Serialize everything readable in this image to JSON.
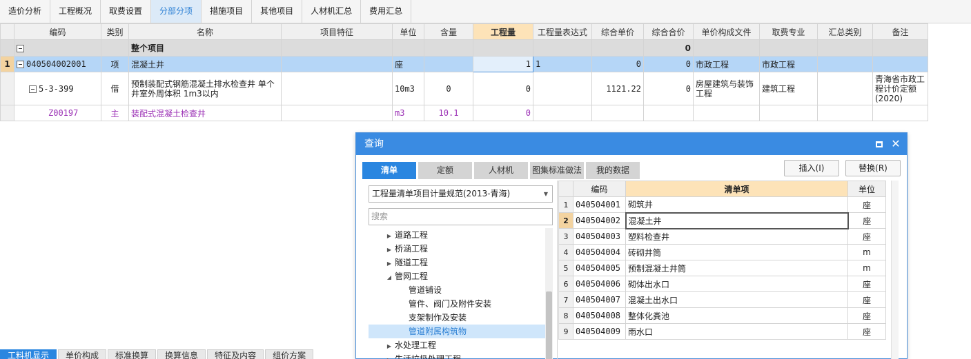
{
  "top_tabs": [
    "造价分析",
    "工程概况",
    "取费设置",
    "分部分项",
    "措施项目",
    "其他项目",
    "人材机汇总",
    "费用汇总"
  ],
  "active_top_tab": "分部分项",
  "grid": {
    "headers": [
      "编码",
      "类别",
      "名称",
      "项目特征",
      "单位",
      "含量",
      "工程量",
      "工程量表达式",
      "综合单价",
      "综合合价",
      "单价构成文件",
      "取费专业",
      "汇总类别",
      "备注"
    ],
    "total_row": {
      "label": "整个项目",
      "amount": "0"
    },
    "row1": {
      "num": "1",
      "code": "040504002001",
      "type": "项",
      "name": "混凝土井",
      "unit": "座",
      "qty": "1",
      "qty_expr": "1",
      "unit_price": "0",
      "total_price": "0",
      "pricing_file": "市政工程",
      "fee_type": "市政工程"
    },
    "row2": {
      "code": "5-3-399",
      "type": "借",
      "name": "预制装配式钢筋混凝土排水检查井 单个井室外周体积 1m3以内",
      "unit": "10m3",
      "content": "0",
      "qty": "0",
      "unit_price": "1121.22",
      "total_price": "0",
      "pricing_file": "房屋建筑与装饰工程",
      "fee_type": "建筑工程",
      "remark": "青海省市政工程计价定额(2020)"
    },
    "row3": {
      "code": "Z00197",
      "type": "主",
      "name": "装配式混凝土检查井",
      "unit": "m3",
      "content": "10.1",
      "qty": "0"
    }
  },
  "bottom_tabs": [
    "工料机显示",
    "单价构成",
    "标准换算",
    "换算信息",
    "特征及内容",
    "组价方案"
  ],
  "dialog": {
    "title": "查询",
    "tabs": [
      "清单",
      "定额",
      "人材机",
      "图集标准做法",
      "我的数据"
    ],
    "active_tab": "清单",
    "insert_label": "插入(I)",
    "replace_label": "替换(R)",
    "library": "工程量清单项目计量规范(2013-青海)",
    "search_placeholder": "搜索",
    "tree": [
      {
        "label": "道路工程",
        "level": 1,
        "arrow": "right"
      },
      {
        "label": "桥涵工程",
        "level": 1,
        "arrow": "right"
      },
      {
        "label": "隧道工程",
        "level": 1,
        "arrow": "right"
      },
      {
        "label": "管网工程",
        "level": 1,
        "arrow": "down"
      },
      {
        "label": "管道铺设",
        "level": 2,
        "arrow": ""
      },
      {
        "label": "管件、阀门及附件安装",
        "level": 2,
        "arrow": ""
      },
      {
        "label": "支架制作及安装",
        "level": 2,
        "arrow": ""
      },
      {
        "label": "管道附属构筑物",
        "level": 2,
        "arrow": "",
        "selected": true
      },
      {
        "label": "水处理工程",
        "level": 1,
        "arrow": "right"
      },
      {
        "label": "生活垃圾处理工程",
        "level": 1,
        "arrow": "right"
      }
    ],
    "list_headers": [
      "编码",
      "清单项",
      "单位"
    ],
    "list_rows": [
      {
        "num": "1",
        "code": "040504001",
        "name": "砌筑井",
        "unit": "座"
      },
      {
        "num": "2",
        "code": "040504002",
        "name": "混凝土井",
        "unit": "座",
        "selected": true
      },
      {
        "num": "3",
        "code": "040504003",
        "name": "塑料检查井",
        "unit": "座"
      },
      {
        "num": "4",
        "code": "040504004",
        "name": "砖砌井筒",
        "unit": "m"
      },
      {
        "num": "5",
        "code": "040504005",
        "name": "预制混凝土井筒",
        "unit": "m"
      },
      {
        "num": "6",
        "code": "040504006",
        "name": "砌体出水口",
        "unit": "座"
      },
      {
        "num": "7",
        "code": "040504007",
        "name": "混凝土出水口",
        "unit": "座"
      },
      {
        "num": "8",
        "code": "040504008",
        "name": "整体化粪池",
        "unit": "座"
      },
      {
        "num": "9",
        "code": "040504009",
        "name": "雨水口",
        "unit": "座"
      }
    ]
  }
}
